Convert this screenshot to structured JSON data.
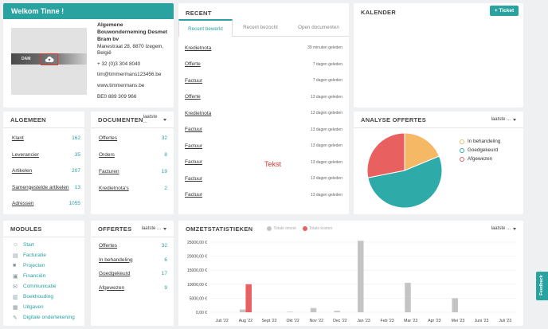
{
  "welcome": {
    "title": "Welkom Tinne !",
    "company_name": "Algemene Bouwonderneming Desmet Bram bv",
    "street": "Manestraat 28, 8870 Izegem,",
    "country": "België",
    "phone": "+ 32 (0)3 304 8040",
    "email": "tim@timmermans123456.be",
    "website": "www.timmermans.be",
    "vat": "BE0 889 309 966",
    "logo_text": "DAM"
  },
  "recent": {
    "title": "RECENT",
    "tabs": [
      "Recent bewerkt",
      "Recent bezocht",
      "Open documenten"
    ],
    "items": [
      {
        "name": "Kredietnota",
        "when": "39 minuten geleden"
      },
      {
        "name": "Offerte",
        "when": "7 dagen geleden"
      },
      {
        "name": "Factuur",
        "when": "7 dagen geleden"
      },
      {
        "name": "Offerte",
        "when": "13 dagen geleden"
      },
      {
        "name": "Kredietnota",
        "when": "13 dagen geleden"
      },
      {
        "name": "Factuur",
        "when": "13 dagen geleden"
      },
      {
        "name": "Factuur",
        "when": "13 dagen geleden"
      },
      {
        "name": "Factuur",
        "when": "13 dagen geleden"
      },
      {
        "name": "Factuur",
        "when": "13 dagen geleden"
      },
      {
        "name": "Factuur",
        "when": "13 dagen geleden"
      }
    ],
    "overlay_text": "Tekst"
  },
  "calendar": {
    "title": "KALENDER",
    "ticket_button": "+ Ticket"
  },
  "algemeen": {
    "title": "ALGEMEEN",
    "items": [
      {
        "label": "Klant",
        "count": "162"
      },
      {
        "label": "Leverancier",
        "count": "35"
      },
      {
        "label": "Artikelen",
        "count": "207"
      },
      {
        "label": "Samengestelde artikelen",
        "count": "13"
      },
      {
        "label": "Adressen",
        "count": "1055"
      }
    ]
  },
  "documenten": {
    "title": "DOCUMENTEN",
    "filter": "laatste ...",
    "items": [
      {
        "label": "Offertes",
        "count": "32"
      },
      {
        "label": "Orders",
        "count": "8"
      },
      {
        "label": "Facturen",
        "count": "19"
      },
      {
        "label": "Kredietnota's",
        "count": "2"
      }
    ]
  },
  "analyse": {
    "title": "ANALYSE OFFERTES",
    "filter": "laatste ...",
    "legend": [
      {
        "label": "In behandeling",
        "color": "#f5b865"
      },
      {
        "label": "Goedgekeurd",
        "color": "#2eaaa8"
      },
      {
        "label": "Afgewezen",
        "color": "#e8605f"
      }
    ]
  },
  "modules": {
    "title": "MODULES",
    "items": [
      {
        "label": "Start",
        "icon": "user-icon"
      },
      {
        "label": "Facturatie",
        "icon": "document-icon"
      },
      {
        "label": "Projecten",
        "icon": "folder-icon"
      },
      {
        "label": "Financiën",
        "icon": "finance-icon"
      },
      {
        "label": "Communicatie",
        "icon": "communication-icon"
      },
      {
        "label": "Boekhouding",
        "icon": "book-icon"
      },
      {
        "label": "Uitgaven",
        "icon": "cart-icon"
      },
      {
        "label": "Digitale ondertekening",
        "icon": "signature-icon"
      }
    ]
  },
  "offertes": {
    "title": "OFFERTES",
    "filter": "laatste ...",
    "items": [
      {
        "label": "Offertes",
        "count": "32"
      },
      {
        "label": "In behandeling",
        "count": "6"
      },
      {
        "label": "Goedgekeurd",
        "count": "17"
      },
      {
        "label": "Afgewezen",
        "count": "9"
      }
    ]
  },
  "omzet": {
    "title": "OMZETSTATISTIEKEN",
    "filter": "laatste ...",
    "legend": [
      {
        "label": "Totale omzet",
        "color": "#c4c4c4"
      },
      {
        "label": "Totale kosten",
        "color": "#e8605f"
      }
    ]
  },
  "feedback": {
    "label": "Feedback"
  },
  "chart_data": [
    {
      "type": "pie",
      "categories": [
        "In behandeling",
        "Goedgekeurd",
        "Afgewezen"
      ],
      "values": [
        6,
        17,
        9
      ],
      "colors": [
        "#f5b865",
        "#2eaaa8",
        "#e8605f"
      ],
      "legend": "right"
    },
    {
      "type": "bar",
      "categories": [
        "Juli '22",
        "Aug '22",
        "Sept '22",
        "Okt '22",
        "Nov '22",
        "Dec '22",
        "Jan '23",
        "Feb '23",
        "Mar '23",
        "Apr '23",
        "Mei '23",
        "Juni '23",
        "Juli '23"
      ],
      "series": [
        {
          "name": "Totale omzet",
          "values": [
            0,
            1000,
            0,
            200,
            1500,
            500,
            25500,
            0,
            10500,
            0,
            5000,
            0,
            0
          ],
          "color": "#c4c4c4"
        },
        {
          "name": "Totale kosten",
          "values": [
            0,
            10000,
            0,
            0,
            0,
            0,
            0,
            0,
            0,
            0,
            0,
            0,
            0
          ],
          "color": "#e8605f"
        }
      ],
      "yticks": [
        "0,00 €",
        "5000,00 €",
        "10000,00 €",
        "15000,00 €",
        "20000,00 €",
        "25000,00 €"
      ],
      "ylim": [
        0,
        25000
      ],
      "grid": true,
      "legend": "top"
    }
  ]
}
